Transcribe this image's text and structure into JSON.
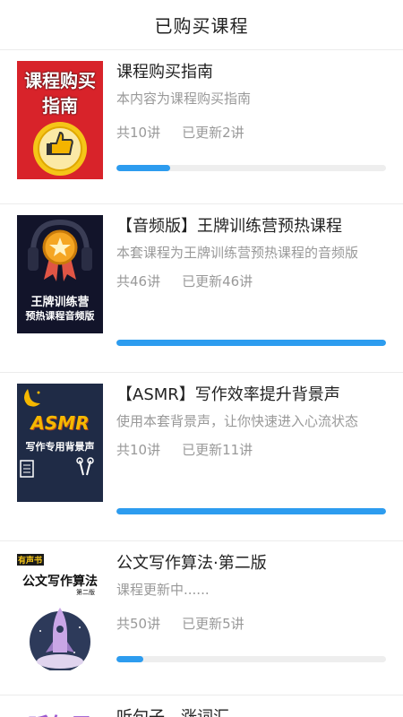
{
  "header": {
    "title": "已购买课程"
  },
  "courses": [
    {
      "cover_text": [
        "课程购买",
        "指南"
      ],
      "title": "课程购买指南",
      "desc": "本内容为课程购买指南",
      "total": "共10讲",
      "updated": "已更新2讲",
      "progress": 0.2,
      "cover_colors": {
        "bg": "#d8232a",
        "text": "#ffffff",
        "accent": "#f5c518"
      }
    },
    {
      "cover_text": [
        "王牌训练营",
        "预热课程音频版"
      ],
      "title": "【音频版】王牌训练营预热课程",
      "desc": "本套课程为王牌训练营预热课程的音频版",
      "total": "共46讲",
      "updated": "已更新46讲",
      "progress": 1.0,
      "cover_colors": {
        "bg": "#12142a",
        "text": "#ffffff",
        "accent": "#f5a623"
      }
    },
    {
      "cover_text": [
        "ASMR",
        "写作专用背景声"
      ],
      "title": "【ASMR】写作效率提升背景声",
      "desc": "使用本套背景声，让你快速进入心流状态",
      "total": "共10讲",
      "updated": "已更新11讲",
      "progress": 1.0,
      "cover_colors": {
        "bg": "#1f2b46",
        "text": "#ffffff",
        "accent": "#f5b800"
      }
    },
    {
      "cover_text": [
        "有声书",
        "公文写作算法",
        "第二版"
      ],
      "title": "公文写作算法·第二版",
      "desc": "课程更新中......",
      "total": "共50讲",
      "updated": "已更新5讲",
      "progress": 0.1,
      "cover_colors": {
        "bg": "#ffffff",
        "text": "#111111",
        "accent": "#2d3a5a"
      }
    },
    {
      "cover_text": [
        "听句子"
      ],
      "title": "听句子，涨词汇",
      "desc": "",
      "total": "",
      "updated": "",
      "progress": 0,
      "cover_colors": {
        "bg": "#ffffff",
        "text": "#9b59d0",
        "accent": "#9b59d0"
      }
    }
  ]
}
